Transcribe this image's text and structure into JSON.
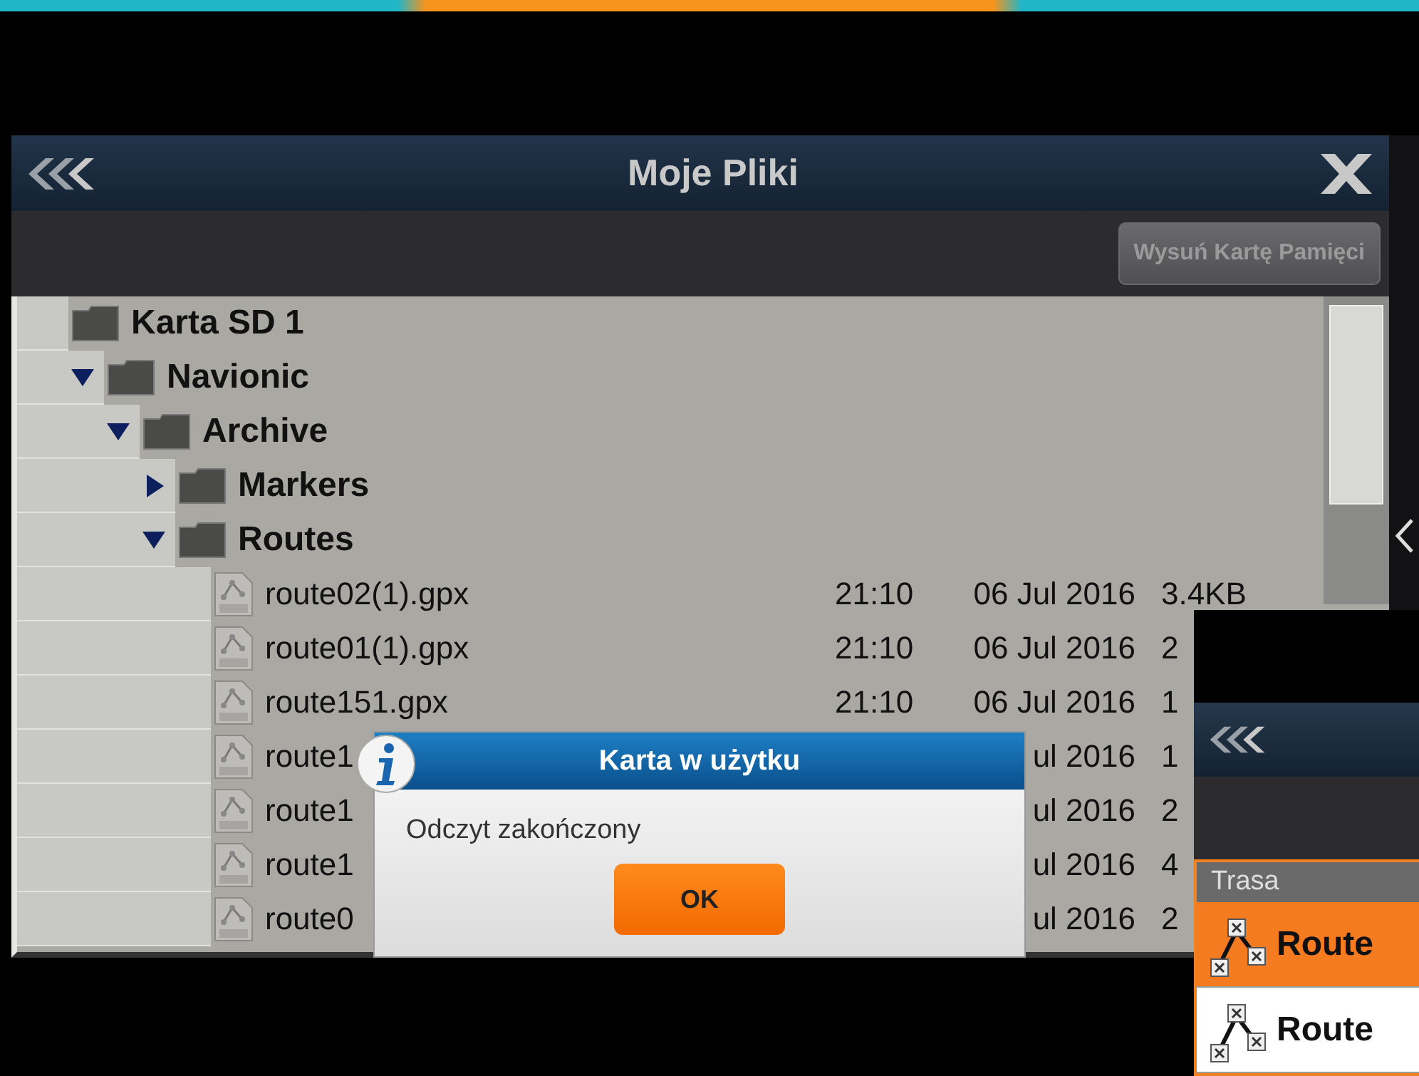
{
  "window": {
    "title": "Moje Pliki"
  },
  "toolbar": {
    "eject_button": "Wysuń Kartę Pamięci"
  },
  "tree": [
    {
      "kind": "folder",
      "name": "Karta SD 1",
      "children": [
        {
          "kind": "folder",
          "name": "Navionic",
          "expanded": true,
          "children": [
            {
              "kind": "folder",
              "name": "Archive",
              "expanded": true,
              "children": [
                {
                  "kind": "folder",
                  "name": "Markers",
                  "expanded": false
                },
                {
                  "kind": "folder",
                  "name": "Routes",
                  "expanded": true,
                  "children": [
                    {
                      "kind": "file",
                      "name": "route02(1).gpx",
                      "time": "21:10",
                      "date": "06 Jul 2016",
                      "size": "3.4KB"
                    },
                    {
                      "kind": "file",
                      "name": "route01(1).gpx",
                      "time": "21:10",
                      "date": "06 Jul 2016",
                      "size": "2"
                    },
                    {
                      "kind": "file",
                      "name": "route151.gpx",
                      "time": "21:10",
                      "date": "06 Jul 2016",
                      "size": "1"
                    },
                    {
                      "kind": "file",
                      "name": "route1",
                      "date": "ul 2016",
                      "size": "1"
                    },
                    {
                      "kind": "file",
                      "name": "route1",
                      "date": "ul 2016",
                      "size": "2"
                    },
                    {
                      "kind": "file",
                      "name": "route1",
                      "date": "ul 2016",
                      "size": "4"
                    },
                    {
                      "kind": "file",
                      "name": "route0",
                      "date": "ul 2016",
                      "size": "2"
                    }
                  ]
                }
              ]
            }
          ]
        }
      ]
    }
  ],
  "dialog": {
    "title": "Karta w użytku",
    "message": "Odczyt zakończony",
    "button": "OK"
  },
  "route_window": {
    "list_header": "Trasa",
    "routes": [
      {
        "name": "Route",
        "selected": true
      },
      {
        "name": "Route",
        "selected": false
      }
    ]
  }
}
